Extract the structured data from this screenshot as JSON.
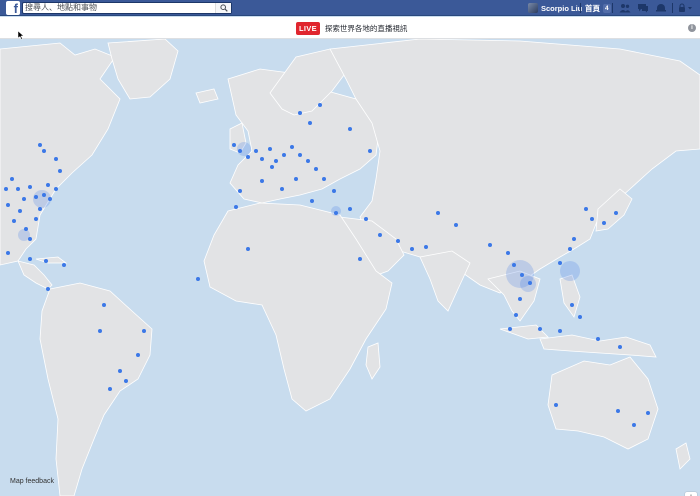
{
  "topbar": {
    "logo": "f",
    "search_placeholder": "搜尋人、地點和事物",
    "profile_name": "Scorpio Liu",
    "home_label": "首頁",
    "home_count": "4",
    "colors": {
      "bar": "#3b5998"
    },
    "icons": [
      "search-icon",
      "friend-requests-icon",
      "messages-icon",
      "notifications-icon",
      "privacy-shortcuts-icon"
    ]
  },
  "banner": {
    "live_label": "LIVE",
    "text": "探索世界各地的直播視訊",
    "info_icon": "i",
    "colors": {
      "live": "#e0262e"
    }
  },
  "map": {
    "feedback_label": "Map feedback",
    "zoom_in": "+",
    "zoom_out": "−",
    "colors": {
      "ocean": "#c8dcee",
      "land": "#e2e3e5",
      "marker": "#3b78e7"
    }
  }
}
